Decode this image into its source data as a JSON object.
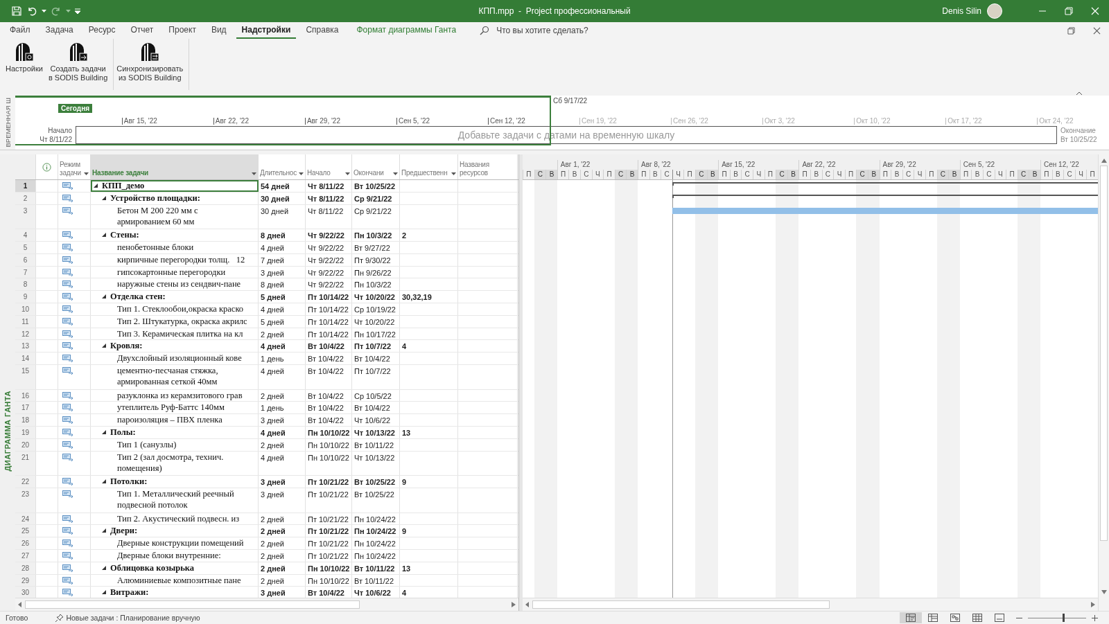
{
  "window": {
    "title": "КПП.mpp  -  Project профессиональный",
    "user": "Denis Silin"
  },
  "tabs": [
    {
      "label": "Файл",
      "selected": false,
      "kind": "tab"
    },
    {
      "label": "Задача",
      "selected": false,
      "kind": "tab"
    },
    {
      "label": "Ресурс",
      "selected": false,
      "kind": "tab"
    },
    {
      "label": "Отчет",
      "selected": false,
      "kind": "tab"
    },
    {
      "label": "Проект",
      "selected": false,
      "kind": "tab"
    },
    {
      "label": "Вид",
      "selected": false,
      "kind": "tab"
    },
    {
      "label": "Надстройки",
      "selected": true,
      "kind": "tab"
    },
    {
      "label": "Справка",
      "selected": false,
      "kind": "tab"
    },
    {
      "label": "Формат диаграммы Ганта",
      "selected": false,
      "kind": "contextual"
    }
  ],
  "tell_me": {
    "placeholder": "Что вы хотите сделать?"
  },
  "ribbon": [
    {
      "buttons": [
        {
          "label": "Настройки",
          "kind": "settings"
        },
        {
          "label": "Создать задачи\nв SODIS Building",
          "kind": "create"
        }
      ]
    },
    {
      "buttons": [
        {
          "label": "Синхронизировать\nиз SODIS Building",
          "kind": "sync"
        }
      ]
    }
  ],
  "timeline": {
    "side_label": "ВРЕМЕННАЯ Ш",
    "today": "Сегодня",
    "range_end": "Сб 9/17/22",
    "start_label": "Начало",
    "start_date": "Чт 8/11/22",
    "end_label": "Окончание",
    "end_date": "Вт 10/25/22",
    "placeholder": "Добавьте задачи с датами на временную шкалу",
    "ticks": [
      {
        "label": "Авг 15, '22",
        "in_view": true
      },
      {
        "label": "Авг 22, '22",
        "in_view": true
      },
      {
        "label": "Авг 29, '22",
        "in_view": true
      },
      {
        "label": "Сен 5, '22",
        "in_view": true
      },
      {
        "label": "Сен 12, '22",
        "in_view": true
      },
      {
        "label": "Сен 19, '22",
        "in_view": false
      },
      {
        "label": "Сен 26, '22",
        "in_view": false
      },
      {
        "label": "Окт 3, '22",
        "in_view": false
      },
      {
        "label": "Окт 10, '22",
        "in_view": false
      },
      {
        "label": "Окт 17, '22",
        "in_view": false
      },
      {
        "label": "Окт 24, '22",
        "in_view": false
      }
    ]
  },
  "view_label": "ДИАГРАММА ГАНТА",
  "columns": [
    {
      "kind": "id",
      "dropdown": false
    },
    {
      "kind": "info",
      "dropdown": false
    },
    {
      "label": "Режим\nзадачи",
      "kind": "mode",
      "dropdown": true
    },
    {
      "label": "Название задачи",
      "kind": "name",
      "dropdown": true
    },
    {
      "label": "Длительнос",
      "kind": "duration",
      "dropdown": true
    },
    {
      "label": "Начало",
      "kind": "start",
      "dropdown": true
    },
    {
      "label": "Окончани",
      "kind": "finish",
      "dropdown": true
    },
    {
      "label": "Предшественн",
      "kind": "predecessors",
      "dropdown": true
    },
    {
      "label": "Названия\nресурсов",
      "kind": "resources",
      "dropdown": false
    }
  ],
  "tasks": [
    {
      "id": "1",
      "kind": "summary",
      "name": "КПП_демо",
      "duration": "54 дней",
      "start": "Чт 8/11/22",
      "finish": "Вт 10/25/22",
      "selected": true,
      "expanded": true,
      "bar": true,
      "children": [
        {
          "id": "2",
          "kind": "summary",
          "name": "Устройство площадки:",
          "duration": "30 дней",
          "start": "Чт 8/11/22",
          "finish": "Ср 9/21/22",
          "selected": false,
          "expanded": true,
          "bar": true,
          "children": [
            {
              "id": "3",
              "kind": "task",
              "name": "Бетон М 200 220 мм с\nармированием 60 мм",
              "duration": "30 дней",
              "start": "Чт 8/11/22",
              "finish": "Ср 9/21/22",
              "selected": false,
              "bar": true
            }
          ]
        },
        {
          "id": "4",
          "kind": "summary",
          "name": "Стены:",
          "duration": "8 дней",
          "start": "Чт 9/22/22",
          "finish": "Пн 10/3/22",
          "predecessors": "2",
          "selected": false,
          "expanded": true,
          "bar": false,
          "children": [
            {
              "id": "5",
              "kind": "task",
              "name": "пенобетонные блоки",
              "duration": "4 дней",
              "start": "Чт 9/22/22",
              "finish": "Вт 9/27/22",
              "selected": false,
              "bar": false
            },
            {
              "id": "6",
              "kind": "task",
              "name": "кирпичные перегородки толщ.   12",
              "duration": "7 дней",
              "start": "Чт 9/22/22",
              "finish": "Пт 9/30/22",
              "selected": false,
              "bar": false
            },
            {
              "id": "7",
              "kind": "task",
              "name": "гипсокартонные перегородки",
              "duration": "3 дней",
              "start": "Чт 9/22/22",
              "finish": "Пн 9/26/22",
              "selected": false,
              "bar": false
            },
            {
              "id": "8",
              "kind": "task",
              "name": "наружные стены из сендвич-пане",
              "duration": "8 дней",
              "start": "Чт 9/22/22",
              "finish": "Пн 10/3/22",
              "selected": false,
              "bar": false
            }
          ]
        },
        {
          "id": "9",
          "kind": "summary",
          "name": "Отделка стен:",
          "duration": "5 дней",
          "start": "Пт 10/14/22",
          "finish": "Чт 10/20/22",
          "predecessors": "30,32,19",
          "selected": false,
          "expanded": true,
          "bar": false,
          "children": [
            {
              "id": "10",
              "kind": "task",
              "name": "Тип 1. Стеклообои,окраска краско",
              "duration": "4 дней",
              "start": "Пт 10/14/22",
              "finish": "Ср 10/19/22",
              "selected": false,
              "bar": false
            },
            {
              "id": "11",
              "kind": "task",
              "name": "Тип 2. Штукатурка, окраска акрилс",
              "duration": "5 дней",
              "start": "Пт 10/14/22",
              "finish": "Чт 10/20/22",
              "selected": false,
              "bar": false
            },
            {
              "id": "12",
              "kind": "task",
              "name": "Тип 3. Керамическая плитка на кл",
              "duration": "2 дней",
              "start": "Пт 10/14/22",
              "finish": "Пн 10/17/22",
              "selected": false,
              "bar": false
            }
          ]
        },
        {
          "id": "13",
          "kind": "summary",
          "name": "Кровля:",
          "duration": "4 дней",
          "start": "Вт 10/4/22",
          "finish": "Пт 10/7/22",
          "predecessors": "4",
          "selected": false,
          "expanded": true,
          "bar": false,
          "children": [
            {
              "id": "14",
              "kind": "task",
              "name": "Двухслойный изоляционный кове",
              "duration": "1 день",
              "start": "Вт 10/4/22",
              "finish": "Вт 10/4/22",
              "selected": false,
              "bar": false
            },
            {
              "id": "15",
              "kind": "task",
              "name": "цементно-песчаная стяжка,\nармированная сеткой 40мм",
              "duration": "4 дней",
              "start": "Вт 10/4/22",
              "finish": "Пт 10/7/22",
              "selected": false,
              "bar": false
            },
            {
              "id": "16",
              "kind": "task",
              "name": "разуклонка из керамзитового грав",
              "duration": "2 дней",
              "start": "Вт 10/4/22",
              "finish": "Ср 10/5/22",
              "selected": false,
              "bar": false
            },
            {
              "id": "17",
              "kind": "task",
              "name": "утеплитель Руф-Баттс 140мм",
              "duration": "1 день",
              "start": "Вт 10/4/22",
              "finish": "Вт 10/4/22",
              "selected": false,
              "bar": false
            },
            {
              "id": "18",
              "kind": "task",
              "name": "пароизоляция – ПВХ пленка",
              "duration": "3 дней",
              "start": "Вт 10/4/22",
              "finish": "Чт 10/6/22",
              "selected": false,
              "bar": false
            }
          ]
        },
        {
          "id": "19",
          "kind": "summary",
          "name": "Полы:",
          "duration": "4 дней",
          "start": "Пн 10/10/22",
          "finish": "Чт 10/13/22",
          "predecessors": "13",
          "selected": false,
          "expanded": true,
          "bar": false,
          "children": [
            {
              "id": "20",
              "kind": "task",
              "name": "Тип 1 (санузлы)",
              "duration": "2 дней",
              "start": "Пн 10/10/22",
              "finish": "Вт 10/11/22",
              "selected": false,
              "bar": false
            },
            {
              "id": "21",
              "kind": "task",
              "name": "Тип 2 (зал досмотра, технич.\nпомещения)",
              "duration": "4 дней",
              "start": "Пн 10/10/22",
              "finish": "Чт 10/13/22",
              "selected": false,
              "bar": false
            }
          ]
        },
        {
          "id": "22",
          "kind": "summary",
          "name": "Потолки:",
          "duration": "3 дней",
          "start": "Пт 10/21/22",
          "finish": "Вт 10/25/22",
          "predecessors": "9",
          "selected": false,
          "expanded": true,
          "bar": false,
          "children": [
            {
              "id": "23",
              "kind": "task",
              "name": "Тип 1. Металлический реечный\nподвесной потолок",
              "duration": "3 дней",
              "start": "Пт 10/21/22",
              "finish": "Вт 10/25/22",
              "selected": false,
              "bar": false
            },
            {
              "id": "24",
              "kind": "task",
              "name": "Тип 2. Акустический подвесн. из",
              "duration": "2 дней",
              "start": "Пт 10/21/22",
              "finish": "Пн 10/24/22",
              "selected": false,
              "bar": false
            }
          ]
        },
        {
          "id": "25",
          "kind": "summary",
          "name": "Двери:",
          "duration": "2 дней",
          "start": "Пт 10/21/22",
          "finish": "Пн 10/24/22",
          "predecessors": "9",
          "selected": false,
          "expanded": true,
          "bar": false,
          "children": [
            {
              "id": "26",
              "kind": "task",
              "name": "Дверные конструкции помещений",
              "duration": "2 дней",
              "start": "Пт 10/21/22",
              "finish": "Пн 10/24/22",
              "selected": false,
              "bar": false
            },
            {
              "id": "27",
              "kind": "task",
              "name": "Дверные блоки внутренние:",
              "duration": "2 дней",
              "start": "Пт 10/21/22",
              "finish": "Пн 10/24/22",
              "selected": false,
              "bar": false
            }
          ]
        },
        {
          "id": "28",
          "kind": "summary",
          "name": "Облицовка козырька",
          "duration": "2 дней",
          "start": "Пн 10/10/22",
          "finish": "Вт 10/11/22",
          "predecessors": "13",
          "selected": false,
          "expanded": true,
          "bar": false,
          "children": [
            {
              "id": "29",
              "kind": "task",
              "name": "Алюминиевые композитные пане",
              "duration": "2 дней",
              "start": "Пн 10/10/22",
              "finish": "Вт 10/11/22",
              "selected": false,
              "bar": false
            }
          ]
        },
        {
          "id": "30",
          "kind": "summary",
          "name": "Витражи:",
          "duration": "3 дней",
          "start": "Вт 10/4/22",
          "finish": "Чт 10/6/22",
          "predecessors": "4",
          "selected": false,
          "expanded": true,
          "bar": false
        }
      ]
    }
  ],
  "gantt": {
    "days": [
      {
        "label": "П",
        "weekend": false,
        "today": false
      },
      {
        "label": "С",
        "weekend": true,
        "today": false
      },
      {
        "label": "В",
        "weekend": true,
        "today": false
      },
      {
        "label": "П",
        "weekend": false,
        "today": false,
        "week": "Авг 1, '22"
      },
      {
        "label": "В",
        "weekend": false,
        "today": false
      },
      {
        "label": "С",
        "weekend": false,
        "today": false
      },
      {
        "label": "Ч",
        "weekend": false,
        "today": false
      },
      {
        "label": "П",
        "weekend": false,
        "today": false
      },
      {
        "label": "С",
        "weekend": true,
        "today": false
      },
      {
        "label": "В",
        "weekend": true,
        "today": false
      },
      {
        "label": "П",
        "weekend": false,
        "today": false,
        "week": "Авг 8, '22"
      },
      {
        "label": "В",
        "weekend": false,
        "today": false
      },
      {
        "label": "С",
        "weekend": false,
        "today": false
      },
      {
        "label": "Ч",
        "weekend": false,
        "today": true
      },
      {
        "label": "П",
        "weekend": false,
        "today": false
      },
      {
        "label": "С",
        "weekend": true,
        "today": false
      },
      {
        "label": "В",
        "weekend": true,
        "today": false
      },
      {
        "label": "П",
        "weekend": false,
        "today": false,
        "week": "Авг 15, '22"
      },
      {
        "label": "В",
        "weekend": false,
        "today": false
      },
      {
        "label": "С",
        "weekend": false,
        "today": false
      },
      {
        "label": "Ч",
        "weekend": false,
        "today": false
      },
      {
        "label": "П",
        "weekend": false,
        "today": false
      },
      {
        "label": "С",
        "weekend": true,
        "today": false
      },
      {
        "label": "В",
        "weekend": true,
        "today": false
      },
      {
        "label": "П",
        "weekend": false,
        "today": false,
        "week": "Авг 22, '22"
      },
      {
        "label": "В",
        "weekend": false,
        "today": false
      },
      {
        "label": "С",
        "weekend": false,
        "today": false
      },
      {
        "label": "Ч",
        "weekend": false,
        "today": false
      },
      {
        "label": "П",
        "weekend": false,
        "today": false
      },
      {
        "label": "С",
        "weekend": true,
        "today": false
      },
      {
        "label": "В",
        "weekend": true,
        "today": false
      },
      {
        "label": "П",
        "weekend": false,
        "today": false,
        "week": "Авг 29, '22"
      },
      {
        "label": "В",
        "weekend": false,
        "today": false
      },
      {
        "label": "С",
        "weekend": false,
        "today": false
      },
      {
        "label": "Ч",
        "weekend": false,
        "today": false
      },
      {
        "label": "П",
        "weekend": false,
        "today": false
      },
      {
        "label": "С",
        "weekend": true,
        "today": false
      },
      {
        "label": "В",
        "weekend": true,
        "today": false
      },
      {
        "label": "П",
        "weekend": false,
        "today": false,
        "week": "Сен 5, '22"
      },
      {
        "label": "В",
        "weekend": false,
        "today": false
      },
      {
        "label": "С",
        "weekend": false,
        "today": false
      },
      {
        "label": "Ч",
        "weekend": false,
        "today": false
      },
      {
        "label": "П",
        "weekend": false,
        "today": false
      },
      {
        "label": "С",
        "weekend": true,
        "today": false
      },
      {
        "label": "В",
        "weekend": true,
        "today": false
      },
      {
        "label": "П",
        "weekend": false,
        "today": false,
        "week": "Сен 12, '22"
      },
      {
        "label": "В",
        "weekend": false,
        "today": false
      },
      {
        "label": "С",
        "weekend": false,
        "today": false
      },
      {
        "label": "Ч",
        "weekend": false,
        "today": false
      },
      {
        "label": "П",
        "weekend": false,
        "today": false
      }
    ]
  },
  "status_bar": {
    "ready": "Готово",
    "new_tasks": "Новые задачи : Планирование вручную",
    "views": [
      {
        "kind": "gantt",
        "selected": true
      },
      {
        "kind": "usage",
        "selected": false
      },
      {
        "kind": "network",
        "selected": false
      },
      {
        "kind": "sheet",
        "selected": false
      },
      {
        "kind": "report",
        "selected": false
      }
    ],
    "zoom": {
      "level": 0.6
    }
  }
}
